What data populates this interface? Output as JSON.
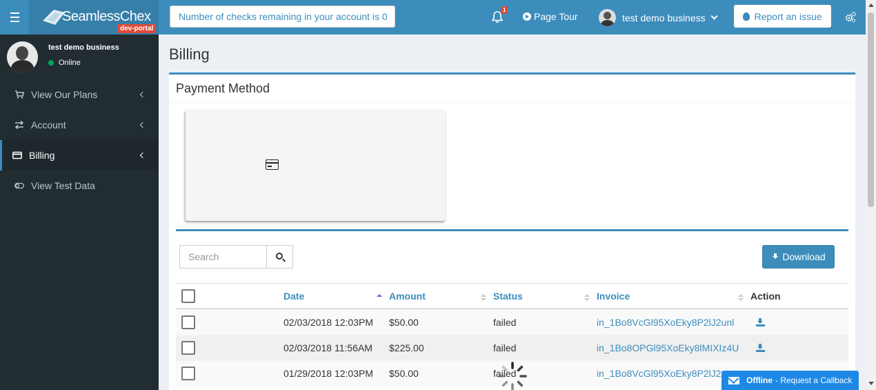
{
  "app": {
    "logo_text": "SeamlessChex",
    "env_badge": "dev-portal"
  },
  "header": {
    "checks_remaining": "Number of checks remaining in your account is 0",
    "notification_count": "1",
    "page_tour": "Page Tour",
    "user_name": "test demo business",
    "report_issue": "Report an issue"
  },
  "sidebar": {
    "user": {
      "name": "test demo business",
      "status": "Online"
    },
    "items": [
      {
        "label": "View Our Plans",
        "icon": "cart-icon",
        "active": false
      },
      {
        "label": "Account",
        "icon": "exchange-icon",
        "active": false
      },
      {
        "label": "Billing",
        "icon": "credit-card-icon",
        "active": true
      },
      {
        "label": "View Test Data",
        "icon": "toggle-icon",
        "active": false
      }
    ]
  },
  "main": {
    "page_title": "Billing",
    "box_title": "Payment Method",
    "search_placeholder": "Search",
    "download_label": "Download",
    "table": {
      "columns": [
        "Date",
        "Amount",
        "Status",
        "Invoice",
        "Action"
      ],
      "sorted_column": "Date",
      "rows": [
        {
          "date": "02/03/2018 12:03PM",
          "amount": "$50.00",
          "status": "failed",
          "invoice": "in_1Bo8VcGl95XoEky8P2lJ2unl"
        },
        {
          "date": "02/03/2018 11:56AM",
          "amount": "$225.00",
          "status": "failed",
          "invoice": "in_1Bo8OPGl95XoEky8lMIXIz4U"
        },
        {
          "date": "01/29/2018 12:03PM",
          "amount": "$50.00",
          "status": "failed",
          "invoice": "in_1Bo8VcGl95XoEky8P2lJ2"
        }
      ]
    }
  },
  "chat": {
    "status": "Offline",
    "action": "Request a Callback"
  },
  "colors": {
    "primary": "#3c8dbc",
    "sidebar_bg": "#222d32",
    "danger": "#dd4b39",
    "online": "#00a65a"
  }
}
